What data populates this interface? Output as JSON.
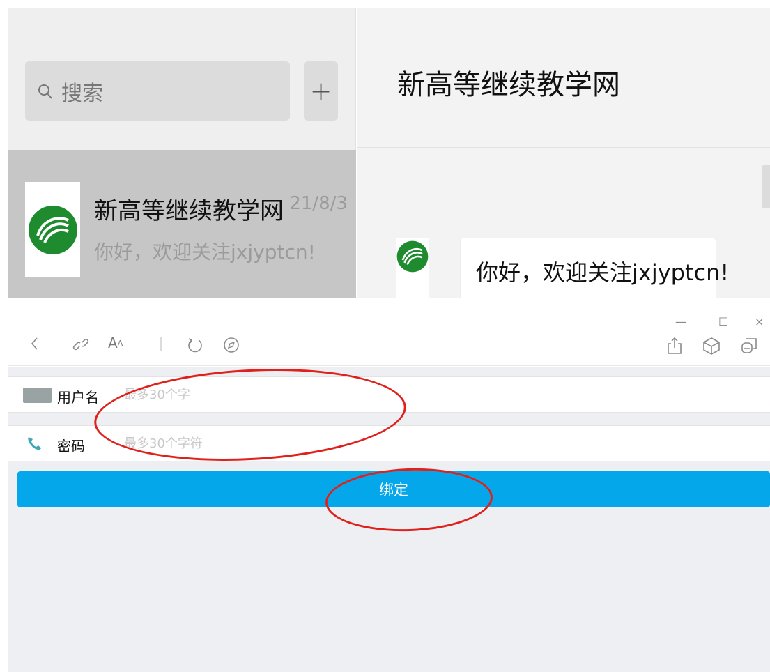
{
  "chat_window": {
    "search": {
      "placeholder": "搜索",
      "icon": "search-icon"
    },
    "add_button": {
      "label": "+"
    },
    "conversation": {
      "name": "新高等继续教学网",
      "preview": "你好，欢迎关注jxjyptcn!",
      "date": "21/8/3"
    },
    "header_title": "新高等继续教学网",
    "message": {
      "text": "你好，欢迎关注jxjyptcn!"
    },
    "brand_color": "#1e8b2f"
  },
  "browser": {
    "toolbar": {
      "icons": [
        "back-icon",
        "link-icon",
        "font-size-icon",
        "refresh-icon",
        "compass-icon",
        "share-icon",
        "3d-box-icon",
        "mini-program-icon"
      ],
      "window_controls": [
        "minimize",
        "maximize",
        "close"
      ]
    },
    "form": {
      "username": {
        "label": "用户名",
        "placeholder": "最多30个字"
      },
      "password": {
        "label": "密码",
        "placeholder": "最多30个字符"
      },
      "bind_button": {
        "label": "绑定"
      }
    },
    "accent_color": "#04a7ea",
    "annotation_color": "#e0211b"
  }
}
